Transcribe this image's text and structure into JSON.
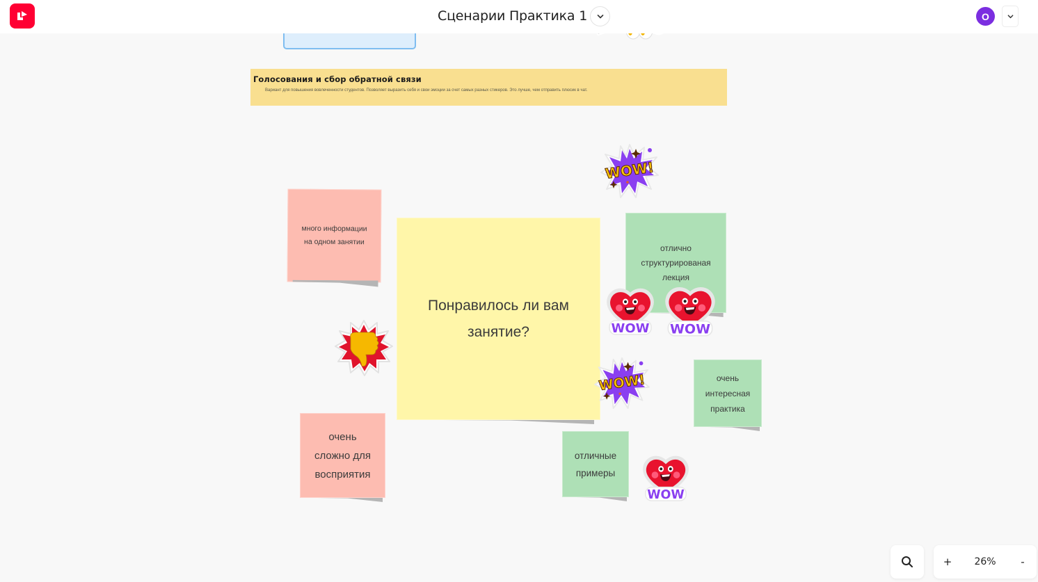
{
  "header": {
    "logo_icon": "app-logo-icon",
    "board_title": "Сценарии Практика 1",
    "title_dropdown_icon": "chevron-down-icon",
    "user_avatar_initial": "O",
    "user_menu_icon": "chevron-down-icon"
  },
  "canvas": {
    "banner": {
      "title": "Голосования и сбор обратной связи",
      "description": "Вариант для повышения вовлеченности студентов. Позволяет выразить себя и свои эмоции за счет самых разных стикеров. Это лучше, чем отправить плюсик в чат.",
      "color": "#f9df90"
    },
    "main_question": {
      "text": "Понравилось ли вам\nзанятие?",
      "color": "#fff6a9"
    },
    "notes": [
      {
        "text": "много информации\nна одном занятии",
        "color": "#fdbcb1"
      },
      {
        "text": "отлично\nструктурированая\nлекция",
        "color": "#aee0b6"
      },
      {
        "text": "очень\nинтересная\nпрактика",
        "color": "#aee0b6"
      },
      {
        "text": "очень\nсложно для\nвосприятия",
        "color": "#fdbcb1"
      },
      {
        "text": "отличные\nпримеры",
        "color": "#aee0b6"
      }
    ],
    "stickers": [
      {
        "type": "wow-burst-sticker",
        "label": "WOW!"
      },
      {
        "type": "wow-burst-sticker",
        "label": "WOW!"
      },
      {
        "type": "heart-wow-sticker",
        "label": "WOW"
      },
      {
        "type": "heart-wow-sticker",
        "label": "WOW"
      },
      {
        "type": "heart-wow-sticker",
        "label": "WOW"
      },
      {
        "type": "thumbs-down-sticker",
        "label": ""
      }
    ]
  },
  "controls": {
    "search_icon": "search-icon",
    "zoom_in_label": "+",
    "zoom_level": "26%",
    "zoom_out_label": "-"
  }
}
